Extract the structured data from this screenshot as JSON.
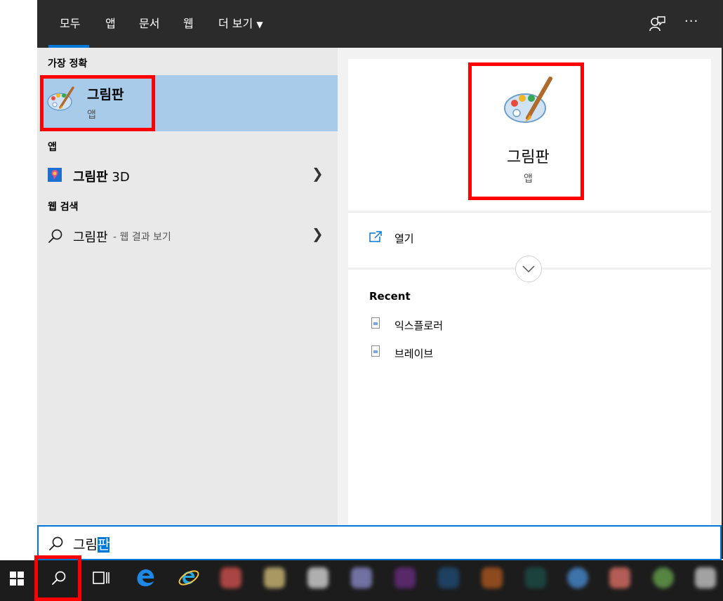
{
  "tabs": [
    "모두",
    "앱",
    "문서",
    "웹",
    "더 보기"
  ],
  "tab_dropdown_glyph": "▼",
  "topbar": {
    "feedback_icon": "feedback-icon",
    "more_label": "···"
  },
  "best_match": {
    "header": "가장 정확",
    "title": "그림판",
    "subtitle": "앱"
  },
  "apps": {
    "header": "앱",
    "items": [
      {
        "label": "그림판",
        "suffix": " 3D"
      }
    ]
  },
  "web": {
    "header": "웹 검색",
    "query": "그림판",
    "hint": " - 웹 결과 보기"
  },
  "preview": {
    "title": "그림판",
    "subtitle": "앱",
    "open_label": "열기",
    "recent_header": "Recent",
    "recent": [
      "익스플로러",
      "브레이브"
    ]
  },
  "search": {
    "typed": "그림",
    "selected": "판"
  },
  "colors": {
    "accent": "#0078d7",
    "highlight": "#a8cbea",
    "annotation": "#ff0000",
    "taskbar": "#1c1c1c"
  }
}
